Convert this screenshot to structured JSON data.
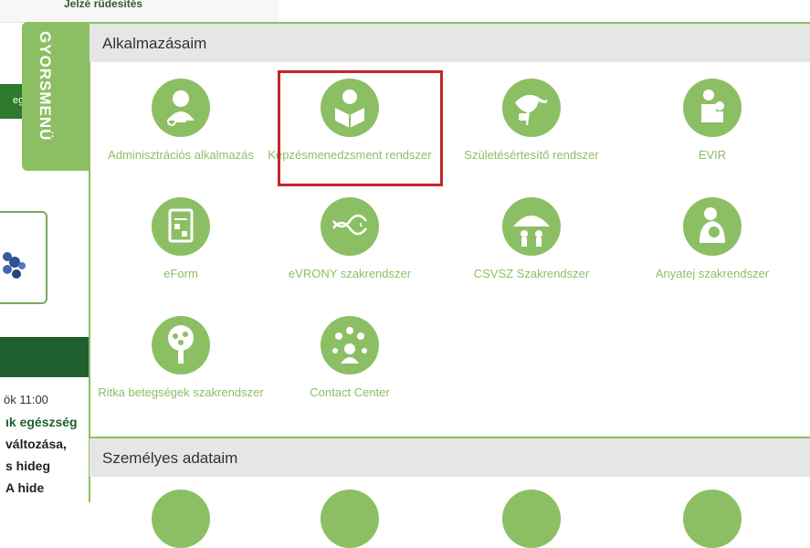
{
  "background": {
    "top_text": "Jelzé rüdesítés",
    "side_label": "eg",
    "time": "ök 11:00",
    "news_lines": [
      "ık egészség",
      "változása,",
      "s   hideg",
      "A   hide"
    ]
  },
  "quick_menu": {
    "label": "GYORSMENÜ"
  },
  "sections": {
    "apps_title": "Alkalmazásaim",
    "personal_title": "Személyes adataim"
  },
  "apps": [
    {
      "label": "Adminisztrációs alkalmazás",
      "icon": "admin-user-icon"
    },
    {
      "label": "Képzésmenedzsment rendszer",
      "icon": "reading-person-icon"
    },
    {
      "label": "Születésértesítő rendszer",
      "icon": "stork-icon"
    },
    {
      "label": "EVIR",
      "icon": "family-icon"
    },
    {
      "label": "eForm",
      "icon": "form-document-icon"
    },
    {
      "label": "eVRONY szakrendszer",
      "icon": "dna-icon"
    },
    {
      "label": "CSVSZ Szakrendszer",
      "icon": "umbrella-family-icon"
    },
    {
      "label": "Anyatej szakrendszer",
      "icon": "mother-baby-icon"
    },
    {
      "label": "Ritka betegségek szakrendszer",
      "icon": "tree-icon"
    },
    {
      "label": "Contact Center",
      "icon": "contact-people-icon"
    }
  ],
  "colors": {
    "accent": "#8cbf64",
    "highlight": "#c3262c",
    "dark_green": "#1f5f2e"
  }
}
